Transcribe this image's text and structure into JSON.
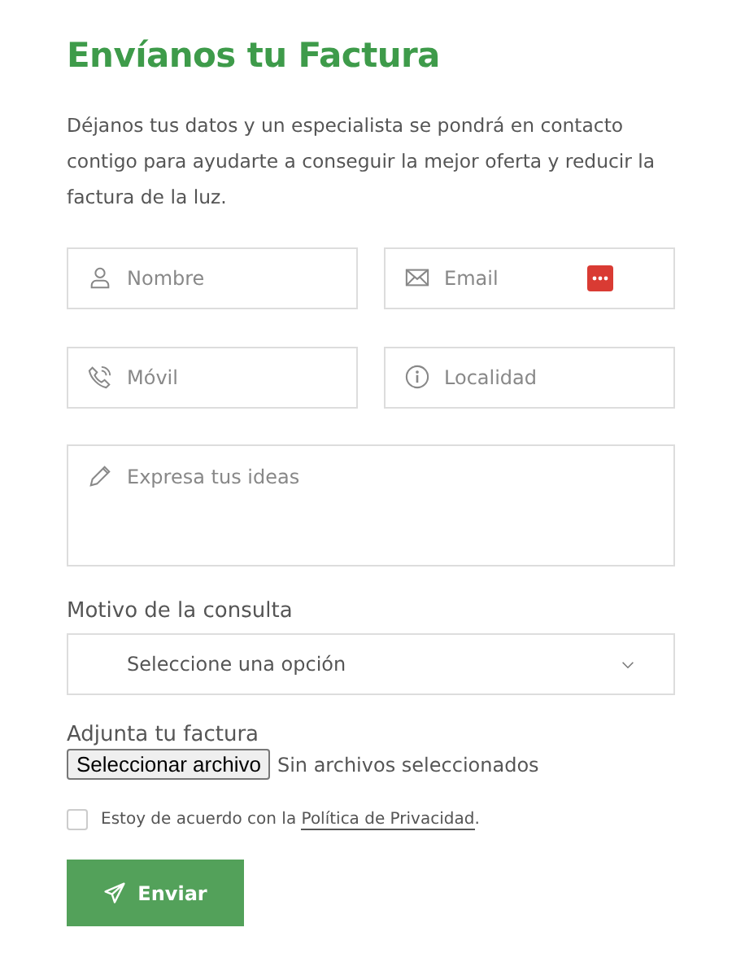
{
  "title": "Envíanos tu Factura",
  "intro": "Déjanos tus datos y un especialista se pondrá en contacto contigo para ayudarte a conseguir la mejor oferta y reducir la factura de la luz.",
  "fields": [
    {
      "kind": "user",
      "placeholder": "Nombre",
      "autofill_badge": false
    },
    {
      "kind": "mail",
      "placeholder": "Email",
      "autofill_badge": true
    },
    {
      "kind": "phone",
      "placeholder": "Móvil",
      "autofill_badge": false
    },
    {
      "kind": "info",
      "placeholder": "Localidad",
      "autofill_badge": false
    }
  ],
  "message": {
    "placeholder": "Expresa tus ideas"
  },
  "reason": {
    "label": "Motivo de la consulta",
    "value": "Seleccione una opción"
  },
  "attachment": {
    "label": "Adjunta tu factura",
    "button": "Seleccionar archivo",
    "status": "Sin archivos seleccionados"
  },
  "consent": {
    "checked": false,
    "text": "Estoy de acuerdo con la ",
    "link": "Política de Privacidad",
    "after": "."
  },
  "submit": {
    "label": "Enviar"
  }
}
